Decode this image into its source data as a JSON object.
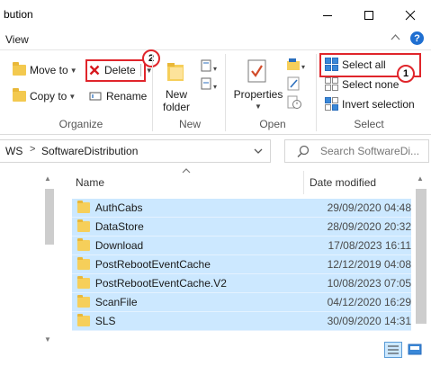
{
  "window": {
    "title": "bution",
    "minimize_icon": "minimize-icon",
    "maximize_icon": "maximize-icon",
    "close_icon": "close-icon"
  },
  "menu": {
    "view_tab": "View"
  },
  "ribbon": {
    "organize": {
      "move_to": "Move to",
      "copy_to": "Copy to",
      "delete": "Delete",
      "rename": "Rename",
      "label": "Organize"
    },
    "new": {
      "new_folder_line1": "New",
      "new_folder_line2": "folder",
      "label": "New"
    },
    "open": {
      "properties": "Properties",
      "label": "Open"
    },
    "select": {
      "select_all": "Select all",
      "select_none": "Select none",
      "invert_selection": "Invert selection",
      "label": "Select"
    },
    "annotations": {
      "badge_1": "1",
      "badge_2": "2"
    }
  },
  "address": {
    "prefix": "WS",
    "separator": ">",
    "current": "SoftwareDistribution",
    "search_placeholder": "Search SoftwareDi..."
  },
  "columns": {
    "name": "Name",
    "date_modified": "Date modified"
  },
  "files": [
    {
      "name": "AuthCabs",
      "date": "29/09/2020 04:48"
    },
    {
      "name": "DataStore",
      "date": "28/09/2020 20:32"
    },
    {
      "name": "Download",
      "date": "17/08/2023 16:11"
    },
    {
      "name": "PostRebootEventCache",
      "date": "12/12/2019 04:08"
    },
    {
      "name": "PostRebootEventCache.V2",
      "date": "10/08/2023 07:05"
    },
    {
      "name": "ScanFile",
      "date": "04/12/2020 16:29"
    },
    {
      "name": "SLS",
      "date": "30/09/2020 14:31"
    }
  ],
  "colors": {
    "accent": "#1f6fd1",
    "selection": "#cce8ff",
    "annotation_red": "#e0252b"
  }
}
